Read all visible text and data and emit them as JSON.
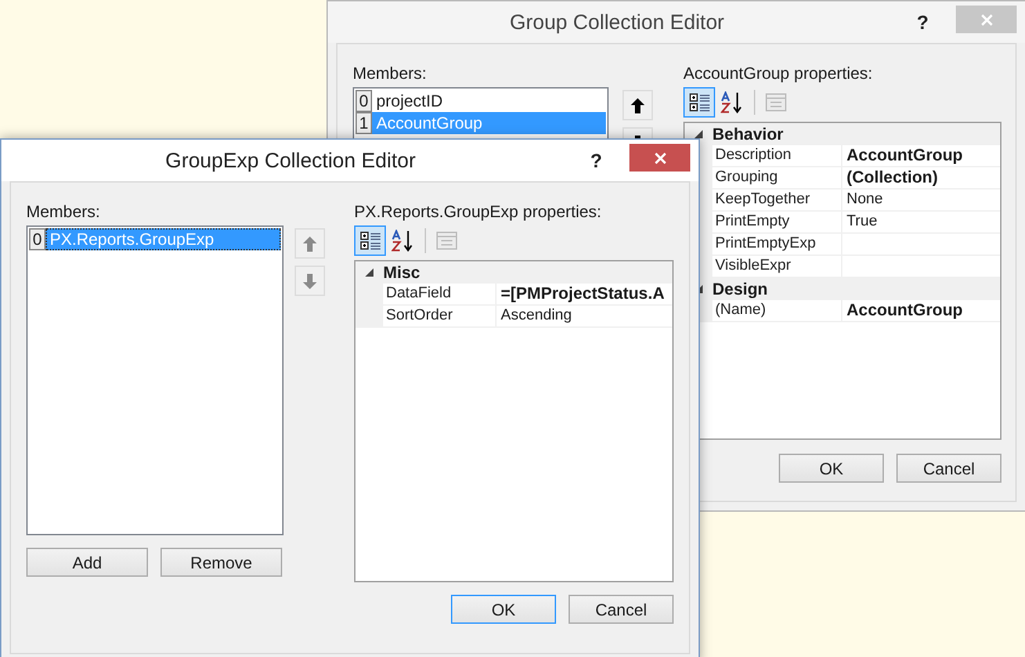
{
  "windows": [
    {
      "title": "Group Collection Editor",
      "active": false,
      "help": "?",
      "members_label": "Members:",
      "members": [
        {
          "index": "0",
          "name": "projectID",
          "selected": false
        },
        {
          "index": "1",
          "name": "AccountGroup",
          "selected": true
        }
      ],
      "move_buttons": [
        {
          "kind": "up",
          "disabled": false
        },
        {
          "kind": "down",
          "disabled": false
        }
      ],
      "properties_label": "AccountGroup properties:",
      "toolbar": [
        {
          "kind": "categorized",
          "selected": true,
          "disabled": false
        },
        {
          "kind": "alphabetical",
          "selected": false,
          "disabled": false
        },
        {
          "kind": "property-pages",
          "selected": false,
          "disabled": true
        }
      ],
      "categories": [
        {
          "name": "Behavior",
          "expanded": true,
          "rows": [
            {
              "name": "Description",
              "value": "AccountGroup",
              "modified": true
            },
            {
              "name": "Grouping",
              "value": "(Collection)",
              "modified": true
            },
            {
              "name": "KeepTogether",
              "value": "None",
              "modified": false
            },
            {
              "name": "PrintEmpty",
              "value": "True",
              "modified": false
            },
            {
              "name": "PrintEmptyExp",
              "value": "",
              "modified": false
            },
            {
              "name": "VisibleExpr",
              "value": "",
              "modified": false
            }
          ]
        },
        {
          "name": "Design",
          "expanded": true,
          "rows": [
            {
              "name": "(Name)",
              "value": "AccountGroup",
              "modified": true
            }
          ]
        }
      ],
      "dialog_buttons": [
        {
          "label": "OK",
          "default": false
        },
        {
          "label": "Cancel",
          "default": false
        }
      ]
    },
    {
      "title": "GroupExp Collection Editor",
      "active": true,
      "help": "?",
      "members_label": "Members:",
      "members": [
        {
          "index": "0",
          "name": "PX.Reports.GroupExp",
          "selected": true
        }
      ],
      "move_buttons": [
        {
          "kind": "up",
          "disabled": true
        },
        {
          "kind": "down",
          "disabled": true
        }
      ],
      "properties_label": "PX.Reports.GroupExp properties:",
      "toolbar": [
        {
          "kind": "categorized",
          "selected": true,
          "disabled": false
        },
        {
          "kind": "alphabetical",
          "selected": false,
          "disabled": false
        },
        {
          "kind": "property-pages",
          "selected": false,
          "disabled": true
        }
      ],
      "categories": [
        {
          "name": "Misc",
          "expanded": true,
          "rows": [
            {
              "name": "DataField",
              "value": "=[PMProjectStatus.A",
              "modified": true
            },
            {
              "name": "SortOrder",
              "value": "Ascending",
              "modified": false
            }
          ]
        }
      ],
      "list_buttons": [
        "Add",
        "Remove"
      ],
      "dialog_buttons": [
        {
          "label": "OK",
          "default": true
        },
        {
          "label": "Cancel",
          "default": false
        }
      ]
    }
  ]
}
